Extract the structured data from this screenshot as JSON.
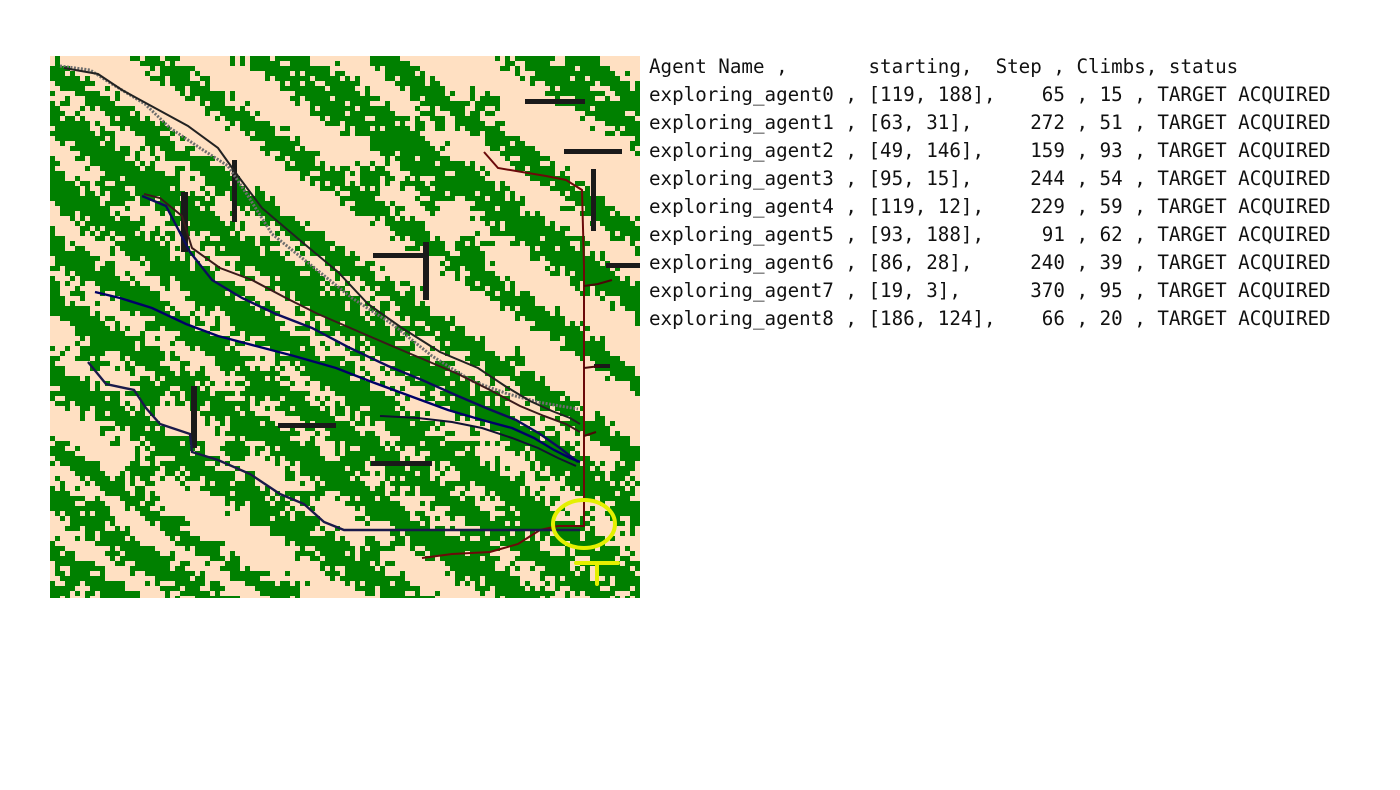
{
  "map": {
    "colors": {
      "ground": "#ffe0c2",
      "vegetation": "#008000",
      "wall": "#1a1a1a",
      "target_marker": "#e4f000"
    },
    "legend_icon": "target-marker-icon"
  },
  "log": {
    "header": {
      "name": "Agent Name ,",
      "start": "starting,",
      "step": "Step ,",
      "climbs": "Climbs,",
      "status": "status"
    },
    "agents": [
      {
        "name": "exploring_agent0",
        "start": "[119, 188],",
        "step": "65",
        "climbs": "15",
        "status": "TARGET ACQUIRED",
        "path_color": "#6e6e6e"
      },
      {
        "name": "exploring_agent1",
        "start": "[63, 31],",
        "step": "272",
        "climbs": "51",
        "status": "TARGET ACQUIRED",
        "path_color": "#222222"
      },
      {
        "name": "exploring_agent2",
        "start": "[49, 146],",
        "step": "159",
        "climbs": "93",
        "status": "TARGET ACQUIRED",
        "path_color": "#6b0a0a"
      },
      {
        "name": "exploring_agent3",
        "start": "[95, 15],",
        "step": "244",
        "climbs": "54",
        "status": "TARGET ACQUIRED",
        "path_color": "#3a1a1a"
      },
      {
        "name": "exploring_agent4",
        "start": "[119, 12],",
        "step": "229",
        "climbs": "59",
        "status": "TARGET ACQUIRED",
        "path_color": "#0c0c5c"
      },
      {
        "name": "exploring_agent5",
        "start": "[93, 188],",
        "step": "91",
        "climbs": "62",
        "status": "TARGET ACQUIRED",
        "path_color": "#4a0808"
      },
      {
        "name": "exploring_agent6",
        "start": "[86, 28],",
        "step": "240",
        "climbs": "39",
        "status": "TARGET ACQUIRED",
        "path_color": "#000066"
      },
      {
        "name": "exploring_agent7",
        "start": "[19, 3],",
        "step": "370",
        "climbs": "95",
        "status": "TARGET ACQUIRED",
        "path_color": "#1a1a4a"
      },
      {
        "name": "exploring_agent8",
        "start": "[186, 124],",
        "step": "66",
        "climbs": "20",
        "status": "TARGET ACQUIRED",
        "path_color": "#111133"
      }
    ]
  }
}
